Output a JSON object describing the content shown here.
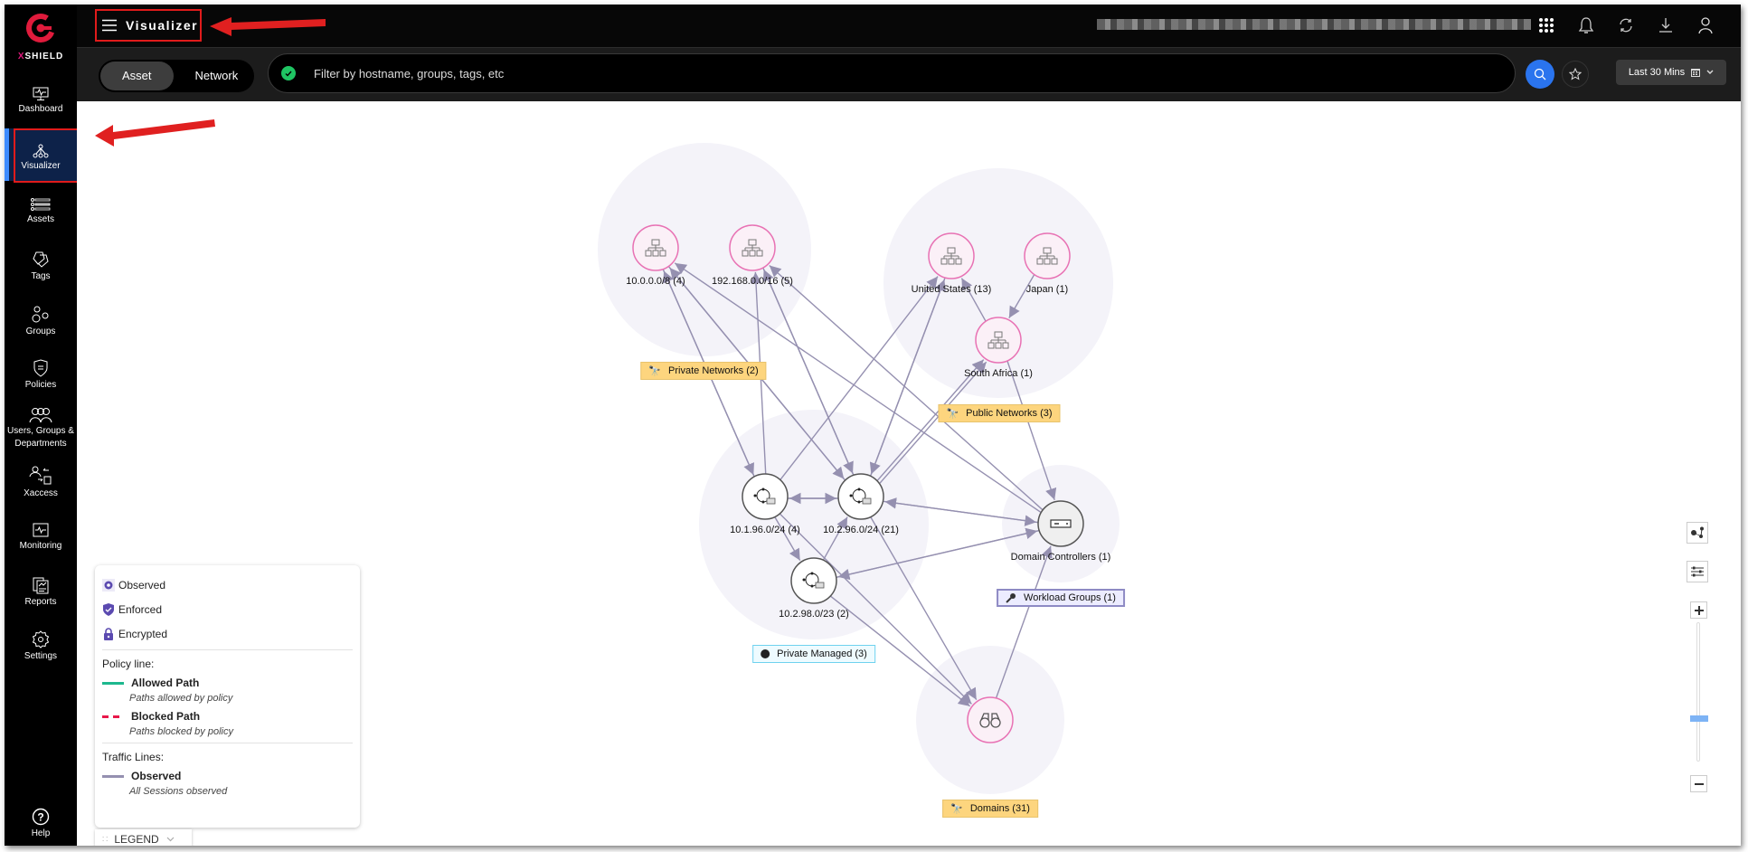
{
  "app": {
    "brand": "SHIELD",
    "brand_prefix": "X",
    "page_title": "Visualizer"
  },
  "sidebar": {
    "items": [
      {
        "label": "Dashboard",
        "icon": "monitor-pulse-icon"
      },
      {
        "label": "Visualizer",
        "icon": "network-tree-icon",
        "active": true
      },
      {
        "label": "Assets",
        "icon": "list-icon"
      },
      {
        "label": "Tags",
        "icon": "tags-icon"
      },
      {
        "label": "Groups",
        "icon": "circles-icon"
      },
      {
        "label": "Policies",
        "icon": "shield-list-icon"
      },
      {
        "label": "Users, Groups &",
        "label2": "Departments",
        "icon": "users-icon"
      },
      {
        "label": "Xaccess",
        "icon": "user-switch-icon"
      },
      {
        "label": "Monitoring",
        "icon": "pulse-box-icon"
      },
      {
        "label": "Reports",
        "icon": "report-icon"
      },
      {
        "label": "Settings",
        "icon": "gear-icon"
      }
    ],
    "help_label": "Help"
  },
  "topbar": {
    "icons": [
      "apps-grid-icon",
      "bell-icon",
      "refresh-icon",
      "download-icon",
      "user-icon"
    ]
  },
  "filterbar": {
    "toggle": [
      {
        "label": "Asset",
        "selected": true
      },
      {
        "label": "Network",
        "selected": false
      }
    ],
    "search_placeholder": "Filter by hostname, groups, tags, etc",
    "time_range": "Last 30 Mins"
  },
  "graph": {
    "groups": [
      {
        "id": "private-networks",
        "label": "Private Networks (2)",
        "style": "yellow",
        "icon": "binoculars-icon"
      },
      {
        "id": "public-networks",
        "label": "Public Networks (3)",
        "style": "yellow",
        "icon": "binoculars-icon"
      },
      {
        "id": "private-managed",
        "label": "Private Managed (3)",
        "style": "cyan",
        "icon": "globe-icon"
      },
      {
        "id": "workload-groups",
        "label": "Workload Groups (1)",
        "style": "purple",
        "icon": "key-icon"
      },
      {
        "id": "domains",
        "label": "Domains (31)",
        "style": "yellow",
        "icon": "binoculars-icon"
      }
    ],
    "nodes": [
      {
        "id": "n10",
        "label": "10.0.0.0/8 (4)",
        "type": "network"
      },
      {
        "id": "n192",
        "label": "192.168.0.0/16 (5)",
        "type": "network"
      },
      {
        "id": "nus",
        "label": "United States (13)",
        "type": "network"
      },
      {
        "id": "njp",
        "label": "Japan (1)",
        "type": "network"
      },
      {
        "id": "nza",
        "label": "South Africa (1)",
        "type": "network"
      },
      {
        "id": "n1196",
        "label": "10.1.96.0/24 (4)",
        "type": "managed"
      },
      {
        "id": "n1296",
        "label": "10.2.96.0/24 (21)",
        "type": "managed"
      },
      {
        "id": "n1298",
        "label": "10.2.98.0/23 (2)",
        "type": "managed"
      },
      {
        "id": "ndc",
        "label": "Domain Controllers (1)",
        "type": "server"
      },
      {
        "id": "ndom",
        "label": "",
        "type": "domain"
      }
    ],
    "edges": [
      [
        "n1196",
        "n10"
      ],
      [
        "n10",
        "n1196"
      ],
      [
        "n1196",
        "n192"
      ],
      [
        "n10",
        "n1296"
      ],
      [
        "n1296",
        "n10"
      ],
      [
        "n192",
        "n1296"
      ],
      [
        "n1296",
        "n192"
      ],
      [
        "n1196",
        "nus"
      ],
      [
        "n1296",
        "nus"
      ],
      [
        "nus",
        "n1296"
      ],
      [
        "n1296",
        "nza"
      ],
      [
        "n1296",
        "nza"
      ],
      [
        "ndc",
        "n10"
      ],
      [
        "ndc",
        "n192"
      ],
      [
        "nza",
        "ndc"
      ],
      [
        "njp",
        "nza"
      ],
      [
        "nza",
        "nus"
      ],
      [
        "n1196",
        "n1296"
      ],
      [
        "n1296",
        "n1196"
      ],
      [
        "ndc",
        "n1296"
      ],
      [
        "n1296",
        "ndc"
      ],
      [
        "n1298",
        "ndc"
      ],
      [
        "ndc",
        "n1298"
      ],
      [
        "n1196",
        "n1298"
      ],
      [
        "n1298",
        "n1296"
      ],
      [
        "n1196",
        "ndom"
      ],
      [
        "n1298",
        "ndom"
      ],
      [
        "n1296",
        "ndom"
      ],
      [
        "ndom",
        "ndc"
      ]
    ]
  },
  "legend": {
    "status": [
      {
        "label": "Observed",
        "icon": "gear-icon"
      },
      {
        "label": "Enforced",
        "icon": "shield-check-icon"
      },
      {
        "label": "Encrypted",
        "icon": "lock-icon"
      }
    ],
    "policy_heading": "Policy line:",
    "policy_lines": [
      {
        "label": "Allowed Path",
        "desc": "Paths allowed by policy",
        "color": "#1db88e",
        "style": "solid"
      },
      {
        "label": "Blocked Path",
        "desc": "Paths blocked by policy",
        "color": "#e8174a",
        "style": "dashed"
      }
    ],
    "traffic_heading": "Traffic Lines:",
    "traffic_lines": [
      {
        "label": "Observed",
        "desc": "All Sessions observed",
        "color": "#9590b0"
      }
    ],
    "toggle_label": "LEGEND"
  },
  "colors": {
    "accent": "#2a74ee",
    "brand": "#e01b3c",
    "node_pink": "#e872b4",
    "edge": "#9590b0",
    "cluster_bg": "#f4f3f9"
  }
}
